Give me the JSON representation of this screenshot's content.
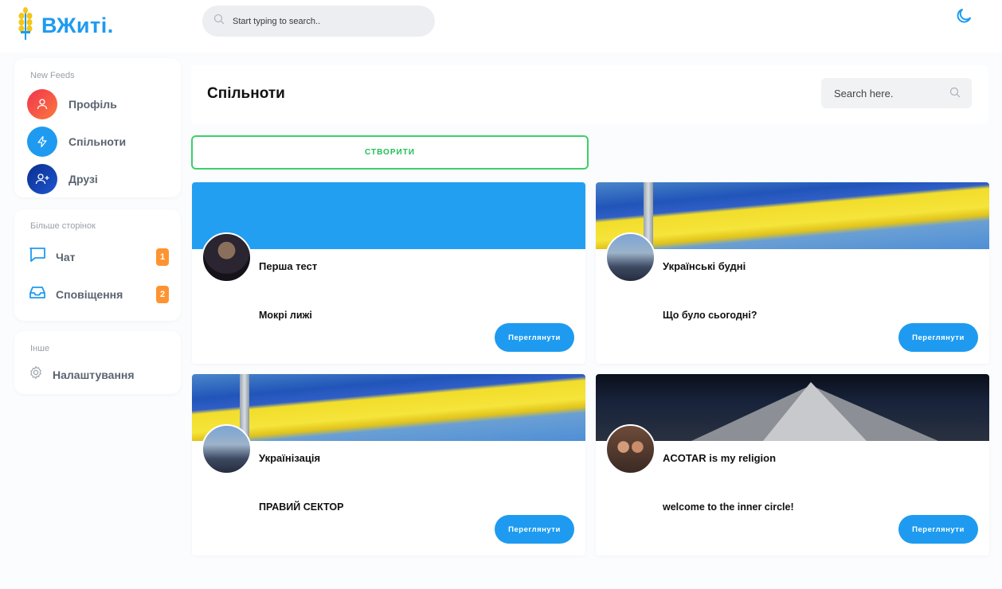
{
  "header": {
    "logo_text": "ВЖиті.",
    "search_placeholder": "Start typing to search..",
    "accent_color": "#1e9bf0"
  },
  "sidebar": {
    "feeds_title": "New Feeds",
    "feeds": [
      {
        "label": "Профіль",
        "icon": "user-icon",
        "color": "#f2334f"
      },
      {
        "label": "Спільноти",
        "icon": "lightning-icon",
        "color": "#1e9bf0"
      },
      {
        "label": "Друзі",
        "icon": "user-plus-icon",
        "color": "#0d3fa8"
      }
    ],
    "pages_title": "Більше сторінок",
    "pages": [
      {
        "label": "Чат",
        "icon": "chat-icon",
        "badge": "1"
      },
      {
        "label": "Сповіщення",
        "icon": "inbox-icon",
        "badge": "2"
      }
    ],
    "other_title": "Інше",
    "other": [
      {
        "label": "Налаштування",
        "icon": "gear-icon"
      }
    ]
  },
  "main": {
    "title": "Спільноти",
    "search_placeholder": "Search here.",
    "create_label": "СТВОРИТИ",
    "view_label": "Переглянути",
    "communities": [
      {
        "name": "Перша тест",
        "description": "Мокрі лижі",
        "cover": "blue"
      },
      {
        "name": "Українські будні",
        "description": "Що було сьогодні?",
        "cover": "ukrainian-flag"
      },
      {
        "name": "Українізація",
        "description": "ПРАВИЙ СЕКТОР",
        "cover": "ukrainian-flag"
      },
      {
        "name": "ACOTAR is my religion",
        "description": "welcome to the inner circle!",
        "cover": "mountain-night"
      }
    ]
  }
}
